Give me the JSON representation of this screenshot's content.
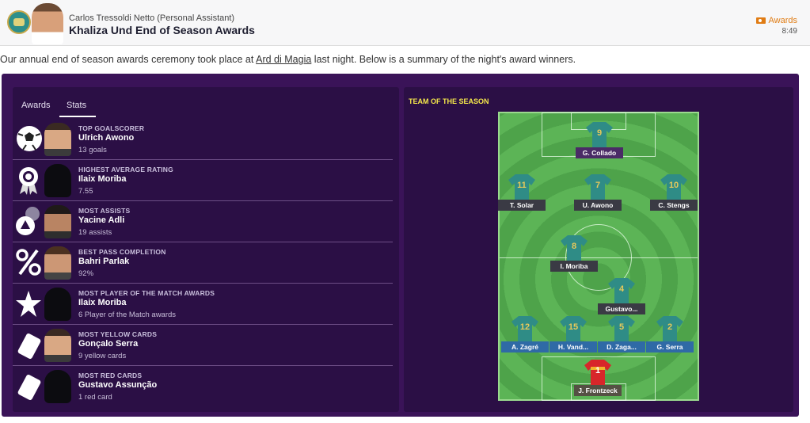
{
  "header": {
    "sender": "Carlos Tressoldi Netto  (Personal Assistant)",
    "subject": "Khaliza Und End of Season Awards",
    "tag": "Awards",
    "time": "8:49"
  },
  "intro": {
    "before": "Our annual end of season awards ceremony took place at ",
    "link": "Ard di Magia",
    "after": " last night. Below is a summary of the night's award winners."
  },
  "tabs": {
    "awards": "Awards",
    "stats": "Stats"
  },
  "awards": [
    {
      "category": "TOP GOALSCORER",
      "player": "Ulrich Awono",
      "value": "13 goals",
      "icon": "football-icon"
    },
    {
      "category": "HIGHEST AVERAGE RATING",
      "player": "Ilaix Moriba",
      "value": "7.55",
      "icon": "rosette-icon"
    },
    {
      "category": "MOST ASSISTS",
      "player": "Yacine Adli",
      "value": "19 assists",
      "icon": "assist-icon"
    },
    {
      "category": "BEST PASS COMPLETION",
      "player": "Bahri Parlak",
      "value": "92%",
      "icon": "percent-icon"
    },
    {
      "category": "MOST PLAYER OF THE MATCH AWARDS",
      "player": "Ilaix Moriba",
      "value": "6 Player of the Match awards",
      "icon": "star-icon"
    },
    {
      "category": "MOST YELLOW CARDS",
      "player": "Gonçalo Serra",
      "value": "9 yellow cards",
      "icon": "yellow-card-icon"
    },
    {
      "category": "MOST RED CARDS",
      "player": "Gustavo Assunção",
      "value": "1 red card",
      "icon": "red-card-icon"
    }
  ],
  "team_of_season": {
    "title": "TEAM OF THE SEASON",
    "players": [
      {
        "number": "9",
        "name": "G. Collado"
      },
      {
        "number": "11",
        "name": "T. Solar"
      },
      {
        "number": "7",
        "name": "U. Awono"
      },
      {
        "number": "10",
        "name": "C. Stengs"
      },
      {
        "number": "8",
        "name": "I. Moriba"
      },
      {
        "number": "4",
        "name": "Gustavo..."
      },
      {
        "number": "12",
        "name": "A. Zagré"
      },
      {
        "number": "15",
        "name": "H. Vand..."
      },
      {
        "number": "5",
        "name": "D. Zaga..."
      },
      {
        "number": "2",
        "name": "G. Serra"
      },
      {
        "number": "1",
        "name": "J. Frontzeck"
      }
    ]
  },
  "colors": {
    "panel": "#3a1358",
    "card": "#2b0f45",
    "tots_title": "#f6e94a",
    "outfield_shirt": "#2f8c86",
    "goalkeeper_shirt": "#d8262a",
    "tag": "#e07c14"
  }
}
